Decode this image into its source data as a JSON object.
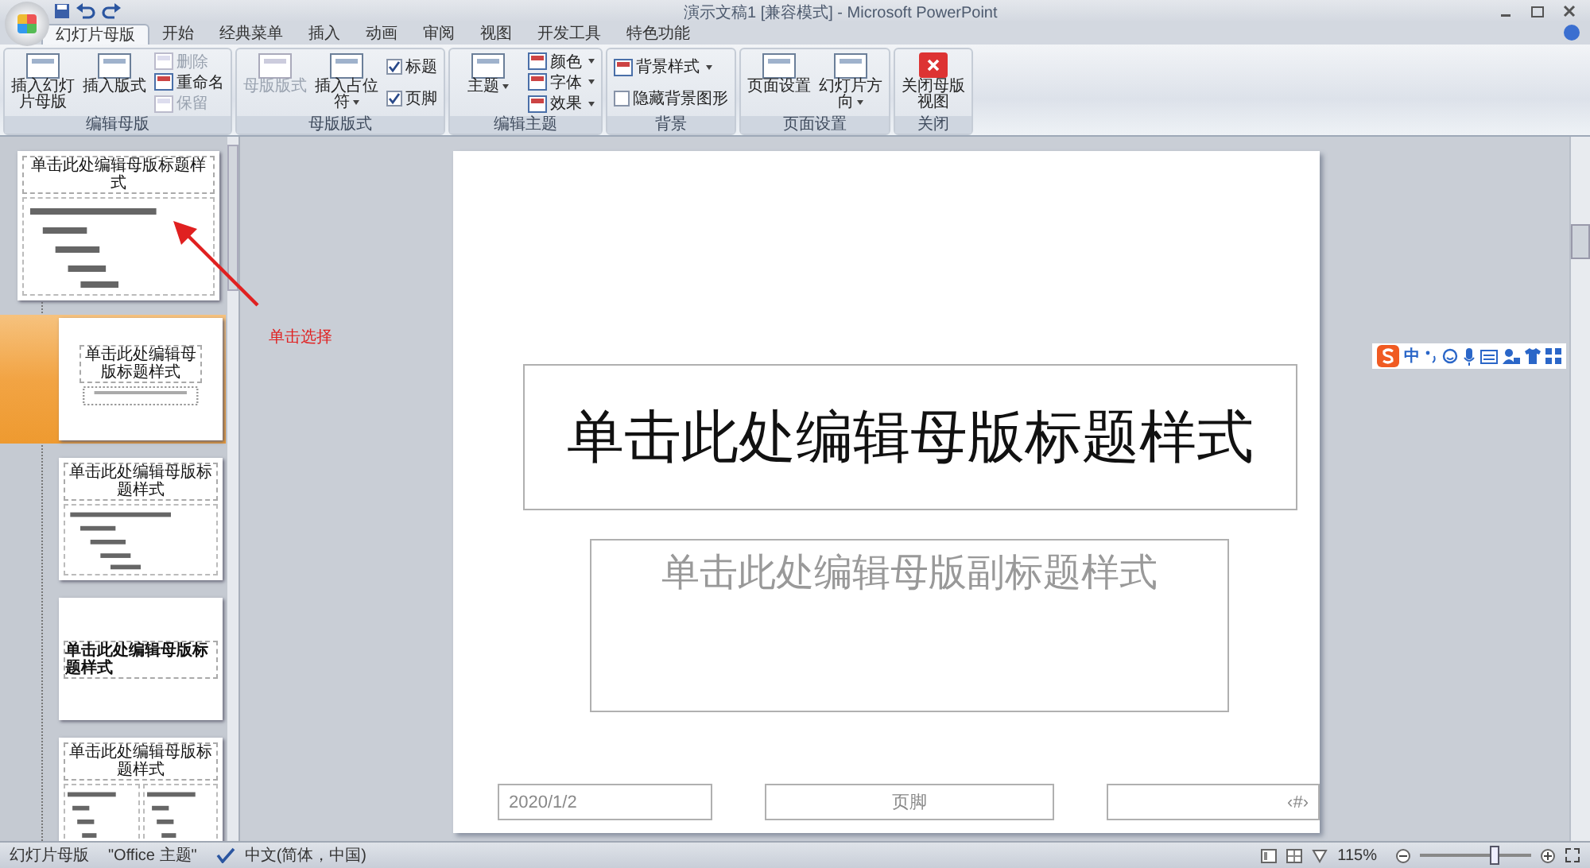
{
  "window": {
    "title": "演示文稿1 [兼容模式] - Microsoft PowerPoint"
  },
  "tabs": [
    {
      "label": "幻灯片母版",
      "selected": true
    },
    {
      "label": "开始",
      "selected": false
    },
    {
      "label": "经典菜单",
      "selected": false
    },
    {
      "label": "插入",
      "selected": false
    },
    {
      "label": "动画",
      "selected": false
    },
    {
      "label": "审阅",
      "selected": false
    },
    {
      "label": "视图",
      "selected": false
    },
    {
      "label": "开发工具",
      "selected": false
    },
    {
      "label": "特色功能",
      "selected": false
    }
  ],
  "ribbon": [
    {
      "label": "编辑母版",
      "items": [
        {
          "kind": "large",
          "label": "插入幻灯片母版",
          "disabled": false,
          "dropdown": false
        },
        {
          "kind": "large",
          "label": "插入版式",
          "disabled": false,
          "dropdown": false
        },
        {
          "kind": "stack",
          "items": [
            {
              "kind": "small",
              "label": "删除",
              "disabled": true,
              "dropdown": false
            },
            {
              "kind": "small",
              "label": "重命名",
              "disabled": false,
              "dropdown": false
            },
            {
              "kind": "small",
              "label": "保留",
              "disabled": true,
              "dropdown": false
            }
          ]
        }
      ]
    },
    {
      "label": "母版版式",
      "items": [
        {
          "kind": "large",
          "label": "母版版式",
          "disabled": true,
          "dropdown": false
        },
        {
          "kind": "large",
          "label": "插入占位符",
          "disabled": false,
          "dropdown": true
        },
        {
          "kind": "stack",
          "items": [
            {
              "kind": "check",
              "label": "标题",
              "checked": true
            },
            {
              "kind": "check",
              "label": "页脚",
              "checked": true
            }
          ]
        }
      ]
    },
    {
      "label": "编辑主题",
      "items": [
        {
          "kind": "large",
          "label": "主题",
          "disabled": false,
          "dropdown": true
        },
        {
          "kind": "stack",
          "items": [
            {
              "kind": "small",
              "label": "颜色",
              "disabled": false,
              "dropdown": true
            },
            {
              "kind": "small",
              "label": "字体",
              "disabled": false,
              "dropdown": true
            },
            {
              "kind": "small",
              "label": "效果",
              "disabled": false,
              "dropdown": true
            }
          ]
        }
      ]
    },
    {
      "label": "背景",
      "items": [
        {
          "kind": "stack",
          "items": [
            {
              "kind": "small",
              "label": "背景样式",
              "disabled": false,
              "dropdown": true
            },
            {
              "kind": "check",
              "label": "隐藏背景图形",
              "checked": false
            }
          ]
        }
      ]
    },
    {
      "label": "页面设置",
      "items": [
        {
          "kind": "large",
          "label": "页面设置",
          "disabled": false,
          "dropdown": false
        },
        {
          "kind": "large",
          "label": "幻灯片方向",
          "disabled": false,
          "dropdown": true
        }
      ]
    },
    {
      "label": "关闭",
      "items": [
        {
          "kind": "close",
          "label": "关闭母版视图",
          "disabled": false,
          "dropdown": false
        }
      ]
    }
  ],
  "thumbnails": [
    {
      "kind": "master",
      "title": "单击此处编辑母版标题样式",
      "selected": false
    },
    {
      "kind": "title-subtitle",
      "title": "单击此处编辑母版标题样式",
      "selected": true
    },
    {
      "kind": "title-body",
      "title": "单击此处编辑母版标题样式",
      "selected": false
    },
    {
      "kind": "section",
      "title": "单击此处编辑母版标题样式",
      "selected": false
    },
    {
      "kind": "two-content",
      "title": "单击此处编辑母版标题样式",
      "selected": false
    }
  ],
  "annotation": {
    "text": "单击选择"
  },
  "slide": {
    "title": "单击此处编辑母版标题样式",
    "subtitle": "单击此处编辑母版副标题样式",
    "date": "2020/1/2",
    "footer": "页脚",
    "number": "‹#›"
  },
  "ime": {
    "mode": "中"
  },
  "status_bar": {
    "view": "幻灯片母版",
    "theme": "\"Office 主题\"",
    "language": "中文(简体，中国)",
    "zoom": "115%",
    "zoom_slider": {
      "level": 0.65
    }
  }
}
